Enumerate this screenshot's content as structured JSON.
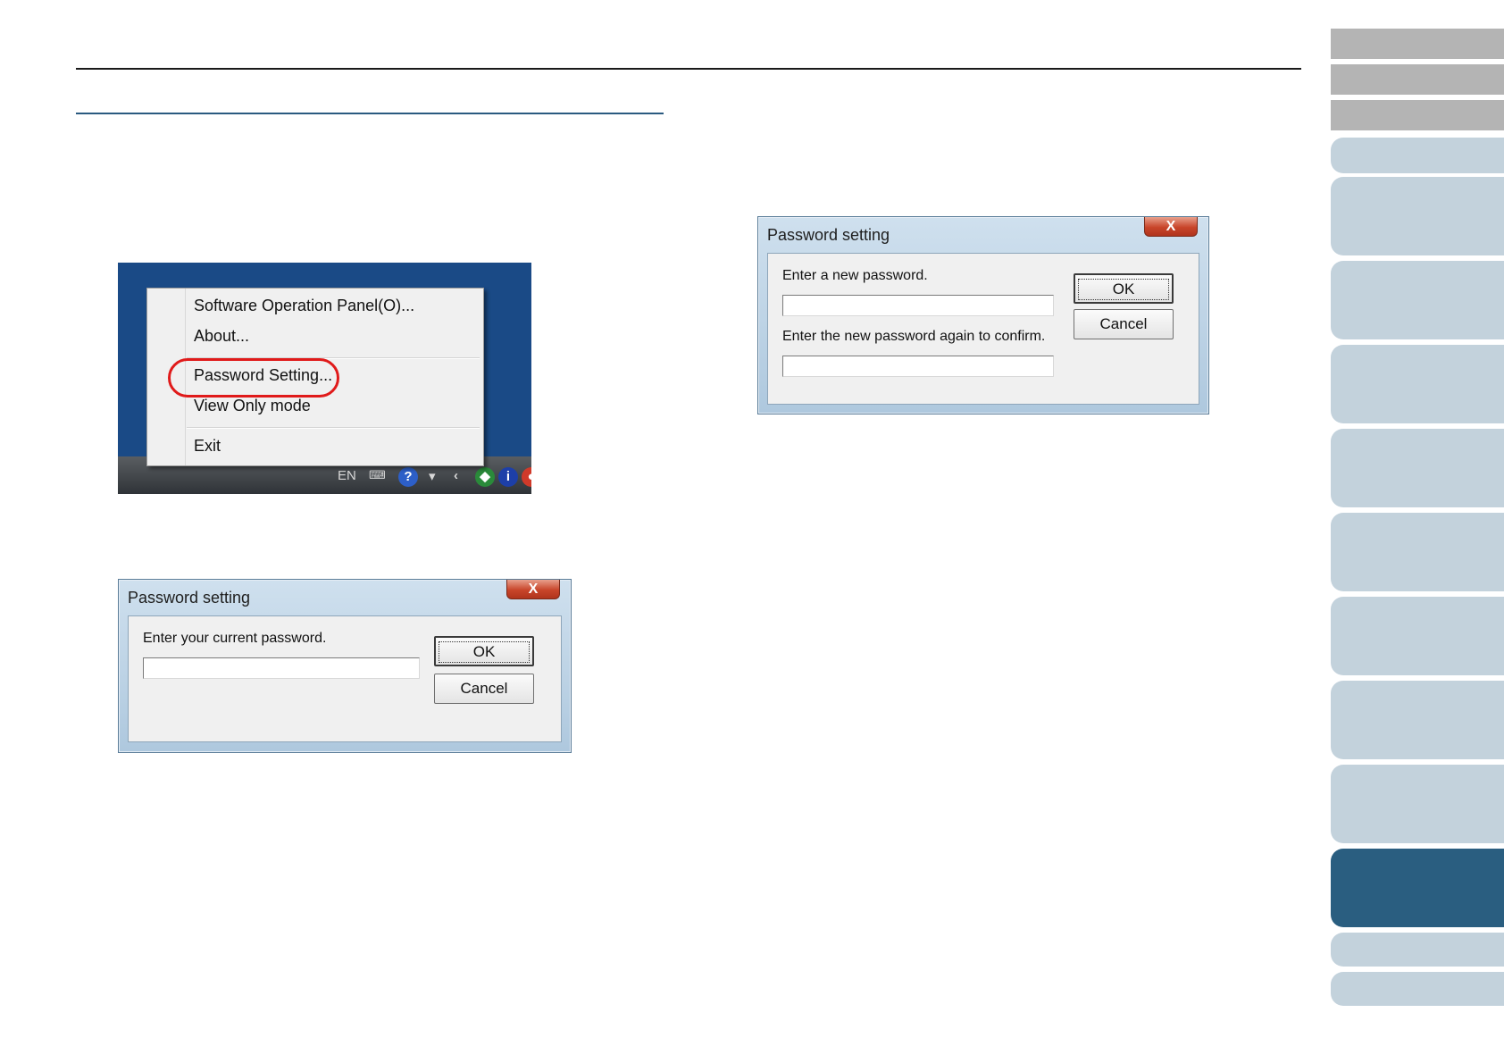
{
  "colors": {
    "rule": "#1a1a1a",
    "section_rule": "#2a5a80",
    "tab_gray": "#b4b4b4",
    "tab_light": "#c3d2dc",
    "tab_active": "#2a5e80",
    "highlight": "#e01a1a",
    "desktop": "#1a4a86"
  },
  "context_menu": {
    "items": [
      "Software Operation Panel(O)...",
      "About...",
      "Password Setting...",
      "View Only mode",
      "Exit"
    ],
    "highlighted_item": "Password Setting...",
    "taskbar_language": "EN"
  },
  "dialog_current": {
    "title": "Password setting",
    "close_label": "X",
    "label": "Enter your current password.",
    "ok_label": "OK",
    "cancel_label": "Cancel"
  },
  "dialog_new": {
    "title": "Password setting",
    "close_label": "X",
    "label_new": "Enter a new password.",
    "label_confirm": "Enter the new password again to confirm.",
    "ok_label": "OK",
    "cancel_label": "Cancel"
  },
  "side_tabs": {
    "count": 15,
    "active_index": 12
  }
}
